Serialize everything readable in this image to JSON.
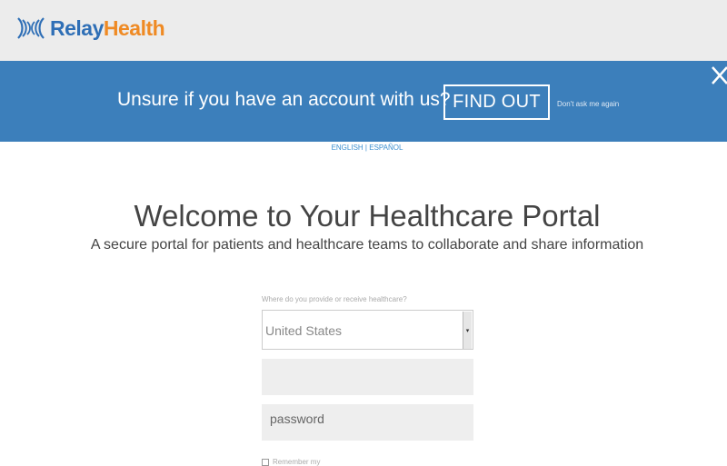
{
  "header": {
    "logo_relay": "Relay",
    "logo_health": "Health"
  },
  "banner": {
    "text": "Unsure if you have an account with us?",
    "find_out": "FIND OUT",
    "dont_ask": "Don't ask me again",
    "close_icon": "close-icon"
  },
  "language": {
    "english": "ENGLISH",
    "separator": "|",
    "spanish": "ESPAÑOL"
  },
  "main": {
    "title": "Welcome to Your Healthcare Portal",
    "subtitle": "A secure portal for patients and healthcare teams to collaborate and share information"
  },
  "form": {
    "country_label": "Where do you provide or receive healthcare?",
    "country_value": "United States",
    "username_value": "",
    "password_placeholder": "password",
    "remember_label": "Remember my"
  },
  "colors": {
    "brand_blue": "#2f6fb6",
    "brand_orange": "#ef8a24",
    "banner_bg": "#3c7fbb",
    "link": "#3c8fd0"
  }
}
